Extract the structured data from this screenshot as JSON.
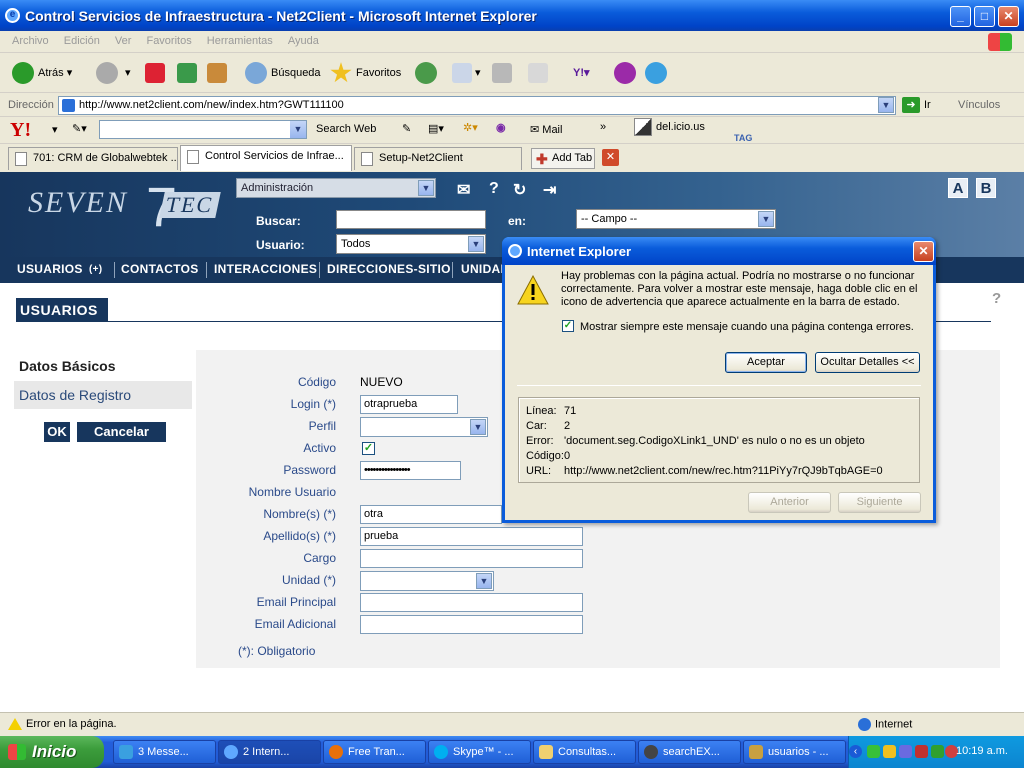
{
  "window": {
    "title": "Control Servicios de Infraestructura - Net2Client - Microsoft Internet Explorer"
  },
  "menu": [
    "Archivo",
    "Edición",
    "Ver",
    "Favoritos",
    "Herramientas",
    "Ayuda"
  ],
  "toolbar": {
    "back": "Atrás",
    "search": "Búsqueda",
    "favorites": "Favoritos"
  },
  "address": {
    "label": "Dirección",
    "url": "http://www.net2client.com/new/index.htm?GWT111100",
    "go": "Ir",
    "links": "Vínculos"
  },
  "yahoo": {
    "logo": "Y!",
    "search_web": "Search Web",
    "mail": "Mail",
    "more": "»",
    "delicious": "del.icio.us",
    "tag": "TAG"
  },
  "tabs": [
    {
      "label": "701: CRM de Globalwebtek ..."
    },
    {
      "label": "Control Servicios de Infrae..."
    },
    {
      "label": "Setup-Net2Client"
    }
  ],
  "add_tab": "Add Tab",
  "site": {
    "brand_left": "SEVEN",
    "brand_num": "7",
    "brand_right": "TEC",
    "module_select": "Administración",
    "buscar_label": "Buscar:",
    "en_label": "en:",
    "campo_select": "-- Campo --",
    "usuario_label": "Usuario:",
    "usuario_select": "Todos",
    "font_a": "A",
    "font_b": "B",
    "help": "?",
    "nav": [
      {
        "label": "USUARIOS"
      },
      {
        "label": "(+)"
      },
      {
        "label": "CONTACTOS"
      },
      {
        "label": "INTERACCIONES"
      },
      {
        "label": "DIRECCIONES-SITIO"
      },
      {
        "label": "UNIDAD"
      }
    ],
    "section_title": "USUARIOS",
    "side_tabs": {
      "basicos": "Datos Básicos",
      "registro": "Datos de Registro"
    },
    "buttons": {
      "ok": "OK",
      "cancel": "Cancelar"
    },
    "form": {
      "codigo_label": "Código",
      "codigo_value": "NUEVO",
      "login_label": "Login (*)",
      "login_value": "otraprueba",
      "perfil_label": "Perfil",
      "activo_label": "Activo",
      "password_label": "Password",
      "password_value": "••••••••••••••••",
      "nombre_usuario_label": "Nombre Usuario",
      "nombres_label": "Nombre(s) (*)",
      "nombres_value": "otra",
      "apellidos_label": "Apellido(s) (*)",
      "apellidos_value": "prueba",
      "cargo_label": "Cargo",
      "unidad_label": "Unidad (*)",
      "email_principal_label": "Email Principal",
      "email_adicional_label": "Email Adicional",
      "obligatorio": "(*): Obligatorio"
    }
  },
  "dialog": {
    "title": "Internet Explorer",
    "message": "Hay problemas con la página actual. Podría no mostrarse o no funcionar correctamente. Para volver a mostrar este mensaje, haga doble clic en el icono de advertencia que aparece actualmente en la barra de estado.",
    "checkbox": "Mostrar siempre este mensaje cuando una página contenga errores.",
    "accept": "Aceptar",
    "hide_details": "Ocultar Detalles <<",
    "details": [
      {
        "key": "Línea:",
        "value": "71"
      },
      {
        "key": "Car:",
        "value": "2"
      },
      {
        "key": "Error:",
        "value": "'document.seg.CodigoXLink1_UND' es nulo o no es un objeto"
      },
      {
        "key": "Código:",
        "value": "0"
      },
      {
        "key": "URL:",
        "value": "http://www.net2client.com/new/rec.htm?11PiYy7rQJ9bTqbAGE=0"
      }
    ],
    "prev": "Anterior",
    "next": "Siguiente"
  },
  "status": {
    "text": "Error en la página.",
    "zone": "Internet"
  },
  "taskbar": {
    "start": "Inicio",
    "tasks": [
      {
        "label": "3 Messe..."
      },
      {
        "label": "2 Intern..."
      },
      {
        "label": "Free Tran..."
      },
      {
        "label": "Skype™ - ..."
      },
      {
        "label": "Consultas..."
      },
      {
        "label": "searchEX..."
      },
      {
        "label": "usuarios - ..."
      }
    ],
    "clock": "10:19 a.m."
  }
}
